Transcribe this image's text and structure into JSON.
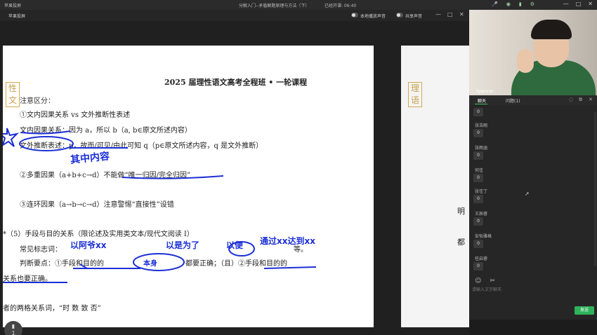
{
  "titlebar": {
    "app_title": "苹果投屏",
    "meeting_title": "分解入门--矛盾解题原理与方法（下）",
    "started_label": "已经开课: 06:40",
    "minimize": "—",
    "maximize": "□",
    "close": "✕"
  },
  "sharebar": {
    "label": "苹果投屏",
    "local_audio": "本地播放声音",
    "share_audio": "共享声音",
    "ctrl_minimize": "—",
    "ctrl_restore": "□",
    "ctrl_close": "✕"
  },
  "slide": {
    "logo": "性\n文",
    "course_title": "2025 届理性语文高考全程班 • 一轮课程",
    "lines": [
      "注意区分：",
      "①文内因果关系 vs 文外推断性表述",
      "文内因果关系：因为 a，所以 b（a, b∈原文所述内容）",
      "文外推断表述：p，故而/可见/由此可知 q（p∈原文所述内容，q 是文外推断）",
      "②多重因果（a+b+c→d）不能做“唯一归因/完全归因”",
      "③连环因果（a→b→c→d）注意警惕“直接性”设错",
      "*（5）手段与目的关系（限论述及实用类文本/现代文阅读 I）",
      "常见标志词：",
      "等。",
      "判断要点：①手段和目的的",
      "都要正确；（且）②手段和目的的",
      "关系也要正确。",
      "者的两格关系词，“时 数 致 否”"
    ],
    "handwriting": [
      "其中内容",
      "以阿爷xx",
      "以是为了",
      "以便",
      "通过xx达到xx",
      "本身"
    ]
  },
  "slide2": {
    "logo": "理\n语",
    "word1": "明",
    "word2": "都"
  },
  "video": {
    "name": "Spencer"
  },
  "chat": {
    "tab_chat": "聊天",
    "tab_questions": "问题(1)",
    "users": [
      {
        "name": "",
        "score": "0"
      },
      {
        "name": "张浩翔",
        "score": "0"
      },
      {
        "name": "张雨涵",
        "score": "0"
      },
      {
        "name": "何佳",
        "score": "0"
      },
      {
        "name": "张佳丁",
        "score": "0"
      },
      {
        "name": "王辰睿",
        "score": "0"
      },
      {
        "name": "安怡雅格",
        "score": "0"
      },
      {
        "name": "任启睿",
        "score": "0"
      }
    ],
    "input_placeholder": "请输入文字聊天",
    "send_label": "发送"
  },
  "floating": {
    "label": "▮\n1"
  }
}
